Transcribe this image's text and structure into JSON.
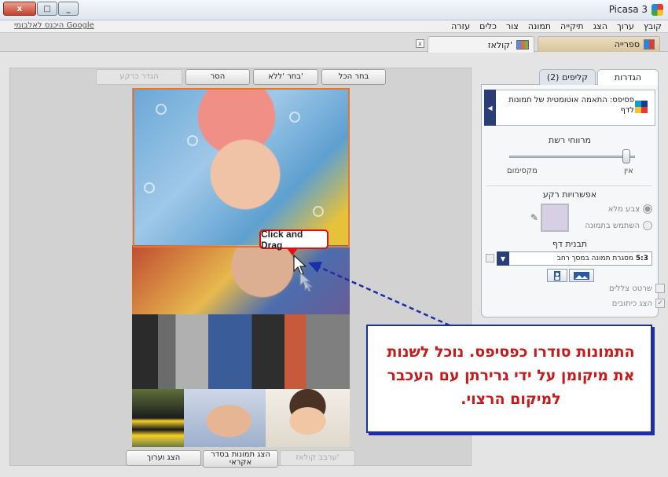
{
  "window": {
    "title": "Picasa 3",
    "controls": [
      "x",
      "□",
      "_"
    ]
  },
  "menu": {
    "items": [
      "קובץ",
      "ערוך",
      "הצג",
      "תיקייה",
      "תמונה",
      "צור",
      "כלים",
      "עזרה"
    ],
    "signin": "היכנס לאלבומי Google"
  },
  "tabs": {
    "library": "ספרייה",
    "collage": "קולאז'",
    "close": "x"
  },
  "toolbar": {
    "select_all": "בחר הכל",
    "select_none": "בחר 'ללא'",
    "remove": "הסר",
    "clear": "הגדר כרקע"
  },
  "bottom_buttons": {
    "view_edit": "הצג וערוך",
    "shuffle": "הצג תמונות בסדר אקראי",
    "collage": "ערבב קולאז'"
  },
  "canvas": {
    "callout": "Click and Drag"
  },
  "panel": {
    "tab_settings": "הגדרות",
    "tab_clips": "קליפים (2)",
    "style": "פסיפס: התאמה אוטומטית של תמונות לדף",
    "grid_spacing_title": "מרווחי רשת",
    "grid_none": "אין",
    "grid_max": "מקסימום",
    "background_title": "אפשרויות רקע",
    "bg_solid": "צבע מלא",
    "bg_image": "השתמש בתמונה",
    "swatch_color": "#d7cfe3",
    "page_template_title": "תבנית דף",
    "template_ratio": "5:3",
    "template_text": "מסגרת תמונה במסך רחב",
    "show_frames": "שרטט צללים",
    "show_captions": "הצג כיתובים"
  },
  "note": {
    "text": "התמונות סודרו כפסיפס. נוכל לשנות את מיקומן על ידי גרירתן עם העכבר למיקום הרצוי."
  },
  "colors": {
    "accent": "#d11111",
    "note_border": "#1d2ea8",
    "arrow": "#1d2ea8",
    "selection": "#e8752f"
  }
}
